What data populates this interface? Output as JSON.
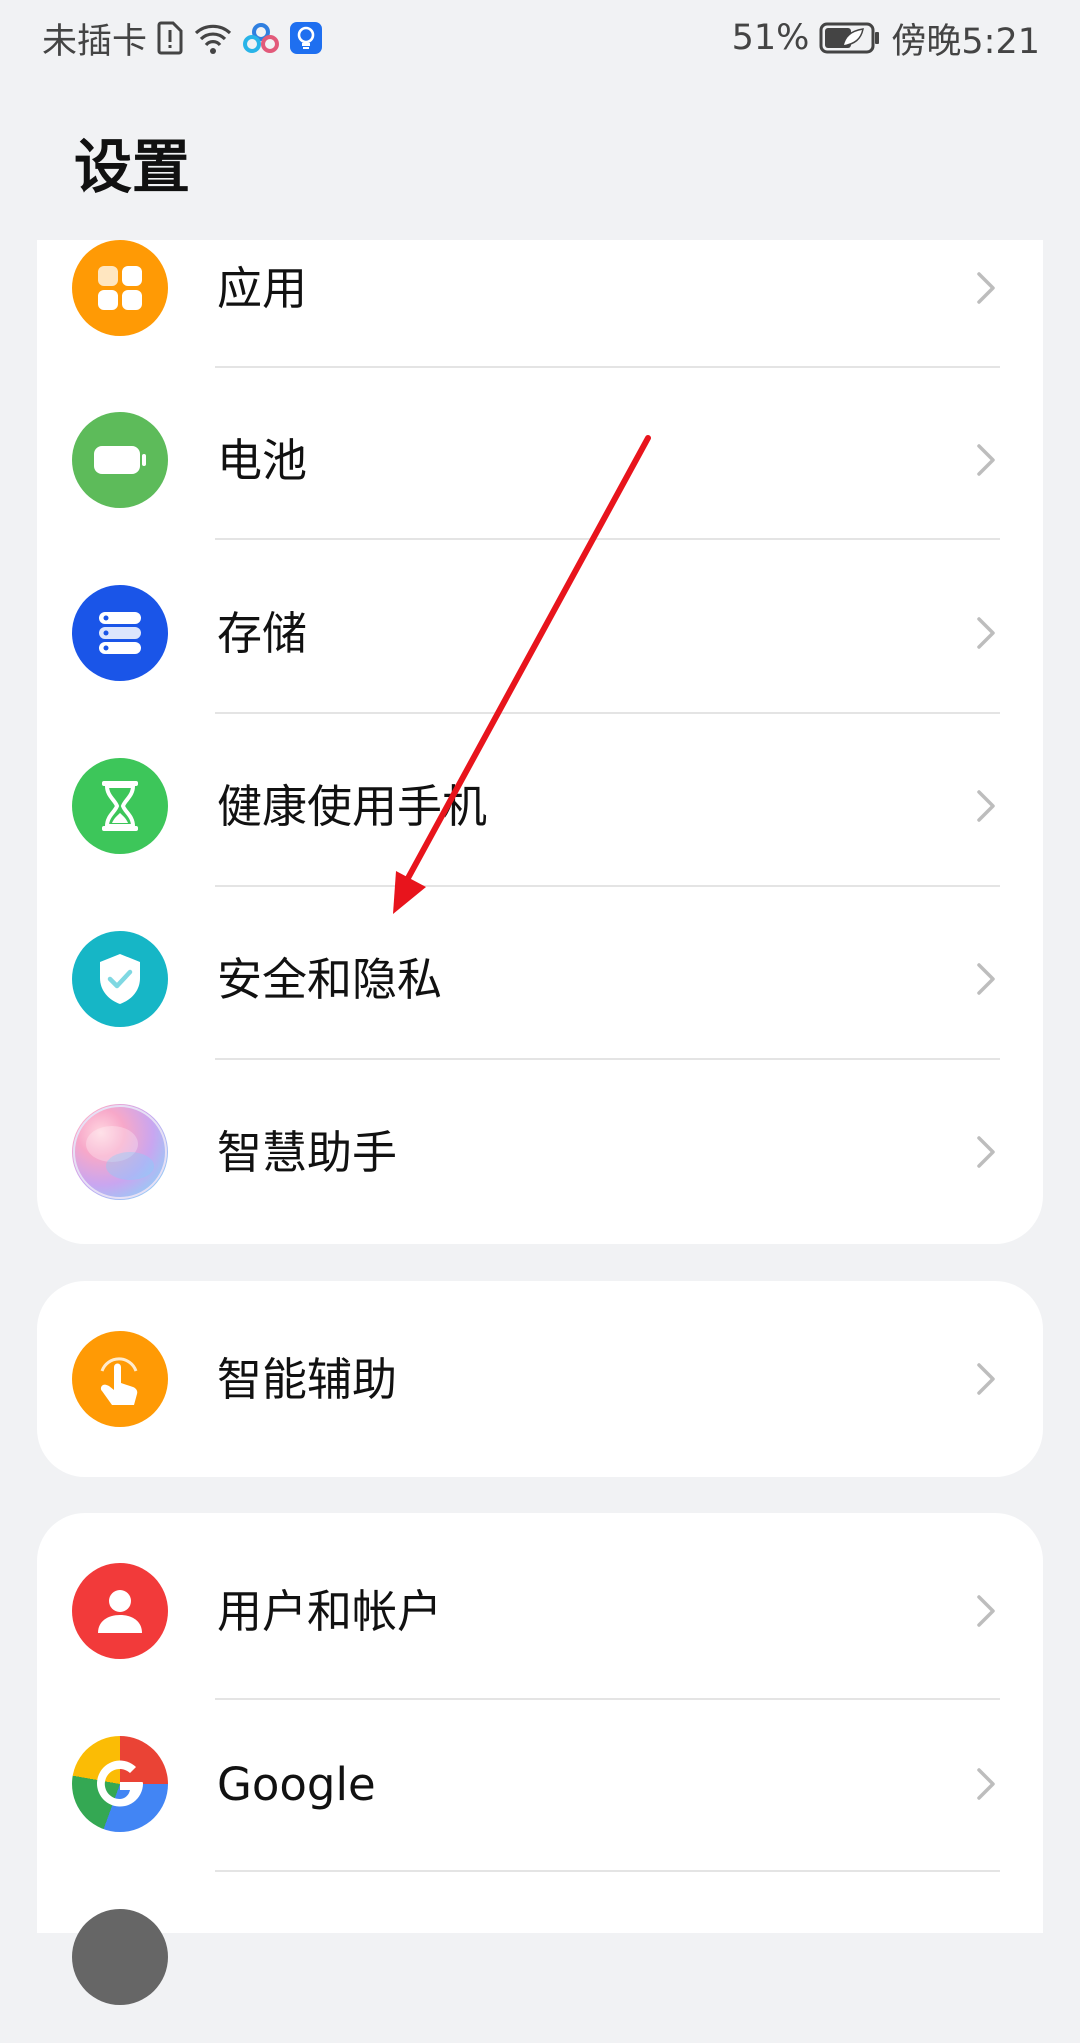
{
  "status_bar": {
    "carrier": "未插卡",
    "battery": "51%",
    "time": "傍晚5:21",
    "icons": [
      "sim-alert-icon",
      "wifi-icon",
      "app-notify-icon",
      "tips-icon",
      "battery-icon"
    ]
  },
  "page": {
    "title": "设置"
  },
  "groups": [
    {
      "items": [
        {
          "label": "应用",
          "icon": "apps-icon",
          "color": "#ff9a05"
        },
        {
          "label": "电池",
          "icon": "battery-icon",
          "color": "#5dbb5a"
        },
        {
          "label": "存储",
          "icon": "storage-icon",
          "color": "#1a55e8"
        },
        {
          "label": "健康使用手机",
          "icon": "hourglass-icon",
          "color": "#3dc65a"
        },
        {
          "label": "安全和隐私",
          "icon": "shield-icon",
          "color": "#16b6c6"
        },
        {
          "label": "智慧助手",
          "icon": "assistant-icon",
          "color": "#c9a6f0"
        }
      ]
    },
    {
      "items": [
        {
          "label": "智能辅助",
          "icon": "tap-hand-icon",
          "color": "#ff9a05"
        }
      ]
    },
    {
      "items": [
        {
          "label": "用户和帐户",
          "icon": "user-icon",
          "color": "#f23a3a"
        },
        {
          "label": "Google",
          "icon": "google-icon",
          "color": "#4285f4"
        },
        {
          "label": "",
          "icon": "system-icon",
          "color": "#666666"
        }
      ]
    }
  ],
  "annotation": {
    "color": "#e8141c"
  }
}
